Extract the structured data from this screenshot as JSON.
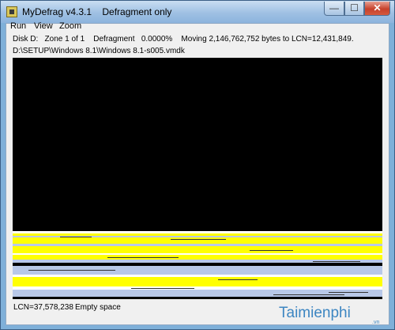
{
  "window": {
    "title": "MyDefrag v4.3.1    Defragment only",
    "minimize_glyph": "—",
    "maximize_glyph": "☐",
    "close_glyph": "✕"
  },
  "menu": {
    "items": [
      {
        "label": "Run"
      },
      {
        "label": "View"
      },
      {
        "label": "Zoom"
      }
    ]
  },
  "status": {
    "line1": "Disk D:   Zone 1 of 1    Defragment   0.0000%    Moving 2,146,762,752 bytes to LCN=12,431,849.",
    "line2": "D:\\SETUP\\Windows 8.1\\Windows 8.1-s005.vmdk"
  },
  "footer": {
    "lcn": "LCN=37,578,238",
    "state": "Empty space"
  },
  "colors": {
    "empty": "#000000",
    "data": "#ffff00",
    "allocated": "#b8c8e8",
    "fragment": "#ffffff"
  },
  "watermark": {
    "text": "Taimienphi",
    "sub": ".vn"
  }
}
